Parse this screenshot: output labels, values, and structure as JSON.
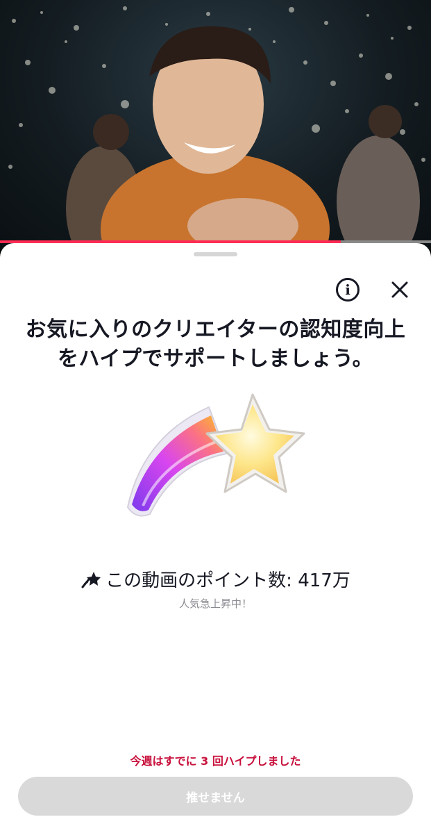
{
  "video": {
    "progress_fraction": 0.79
  },
  "sheet": {
    "headline_line1": "お気に入りのクリエイターの認知度向上",
    "headline_line2": "をハイプでサポートしましょう。",
    "info_glyph": "i",
    "points_label": "この動画のポイント数: 417万",
    "trend_label": "人気急上昇中！",
    "weekly_notice": "今週はすでに 3 回ハイプしました",
    "cta_label": "推せません"
  },
  "colors": {
    "accent": "#fe2c55",
    "notice": "#c8103c",
    "button_disabled": "#d9d9d9"
  },
  "icons": [
    "info-icon",
    "close-icon",
    "shooting-star-icon",
    "mini-shooting-star-icon"
  ]
}
